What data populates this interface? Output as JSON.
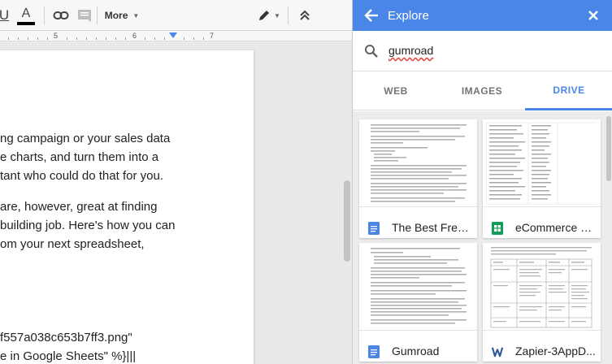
{
  "toolbar": {
    "underline_label": "U",
    "text_color_label": "A",
    "more_label": "More",
    "text_color": "#000000"
  },
  "ruler": {
    "mark_5": "5",
    "mark_6": "6",
    "mark_7": "7"
  },
  "document": {
    "lines": [
      "ng campaign or your sales data",
      "e charts, and turn them into a",
      "tant who could do that for you.",
      "are, however, great at finding",
      "building job. Here's how you can",
      "om your next spreadsheet,",
      "f557a038c653b7ff3.png\"",
      "e in Google Sheets\" %}|||"
    ]
  },
  "explore": {
    "title": "Explore",
    "accent": "#4a86e8",
    "search": {
      "value": "gumroad"
    },
    "tabs": [
      {
        "label": "WEB"
      },
      {
        "label": "IMAGES"
      },
      {
        "label": "DRIVE"
      }
    ],
    "files": [
      {
        "title": "The Best Free ...",
        "type_icon": "docs-icon"
      },
      {
        "title": "eCommerce O...",
        "type_icon": "sheets-icon"
      },
      {
        "title": "Gumroad",
        "type_icon": "docs-icon"
      },
      {
        "title": "Zapier-3AppD...",
        "type_icon": "word-icon"
      }
    ]
  }
}
